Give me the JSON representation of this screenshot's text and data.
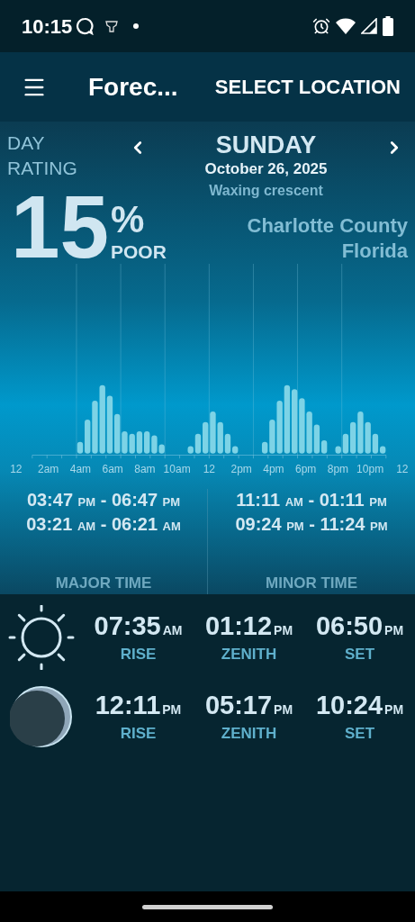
{
  "status_bar": {
    "time": "10:15"
  },
  "toolbar": {
    "title": "Forec...",
    "action": "SELECT LOCATION"
  },
  "rating": {
    "label": "DAY RATING",
    "value": "15",
    "unit": "%",
    "verdict": "POOR"
  },
  "day": {
    "weekday": "SUNDAY",
    "date": "October 26, 2025",
    "moon_phase": "Waxing crescent"
  },
  "location": {
    "county": "Charlotte County",
    "state": "Florida"
  },
  "chart": {
    "axis_labels": [
      "12",
      "2am",
      "4am",
      "6am",
      "8am",
      "10am",
      "12",
      "2pm",
      "4pm",
      "6pm",
      "8pm",
      "10pm",
      "12"
    ]
  },
  "times": [
    {
      "label": "MAJOR TIME",
      "ranges": [
        {
          "start": "03:47",
          "start_suffix": "PM",
          "separator": "-",
          "end": "06:47",
          "end_suffix": "PM"
        },
        {
          "start": "03:21",
          "start_suffix": "AM",
          "separator": "-",
          "end": "06:21",
          "end_suffix": "AM"
        }
      ]
    },
    {
      "label": "MINOR TIME",
      "ranges": [
        {
          "start": "11:11",
          "start_suffix": "AM",
          "separator": "-",
          "end": "01:11",
          "end_suffix": "PM"
        },
        {
          "start": "09:24",
          "start_suffix": "PM",
          "separator": "-",
          "end": "11:24",
          "end_suffix": "PM"
        }
      ]
    }
  ],
  "bodies": [
    {
      "kind": "sun",
      "events": [
        {
          "time": "07:35",
          "suffix": "AM",
          "label": "RISE"
        },
        {
          "time": "01:12",
          "suffix": "PM",
          "label": "ZENITH"
        },
        {
          "time": "06:50",
          "suffix": "PM",
          "label": "SET"
        }
      ]
    },
    {
      "kind": "moon",
      "events": [
        {
          "time": "12:11",
          "suffix": "PM",
          "label": "RISE"
        },
        {
          "time": "05:17",
          "suffix": "PM",
          "label": "ZENITH"
        },
        {
          "time": "10:24",
          "suffix": "PM",
          "label": "SET"
        }
      ]
    }
  ]
}
